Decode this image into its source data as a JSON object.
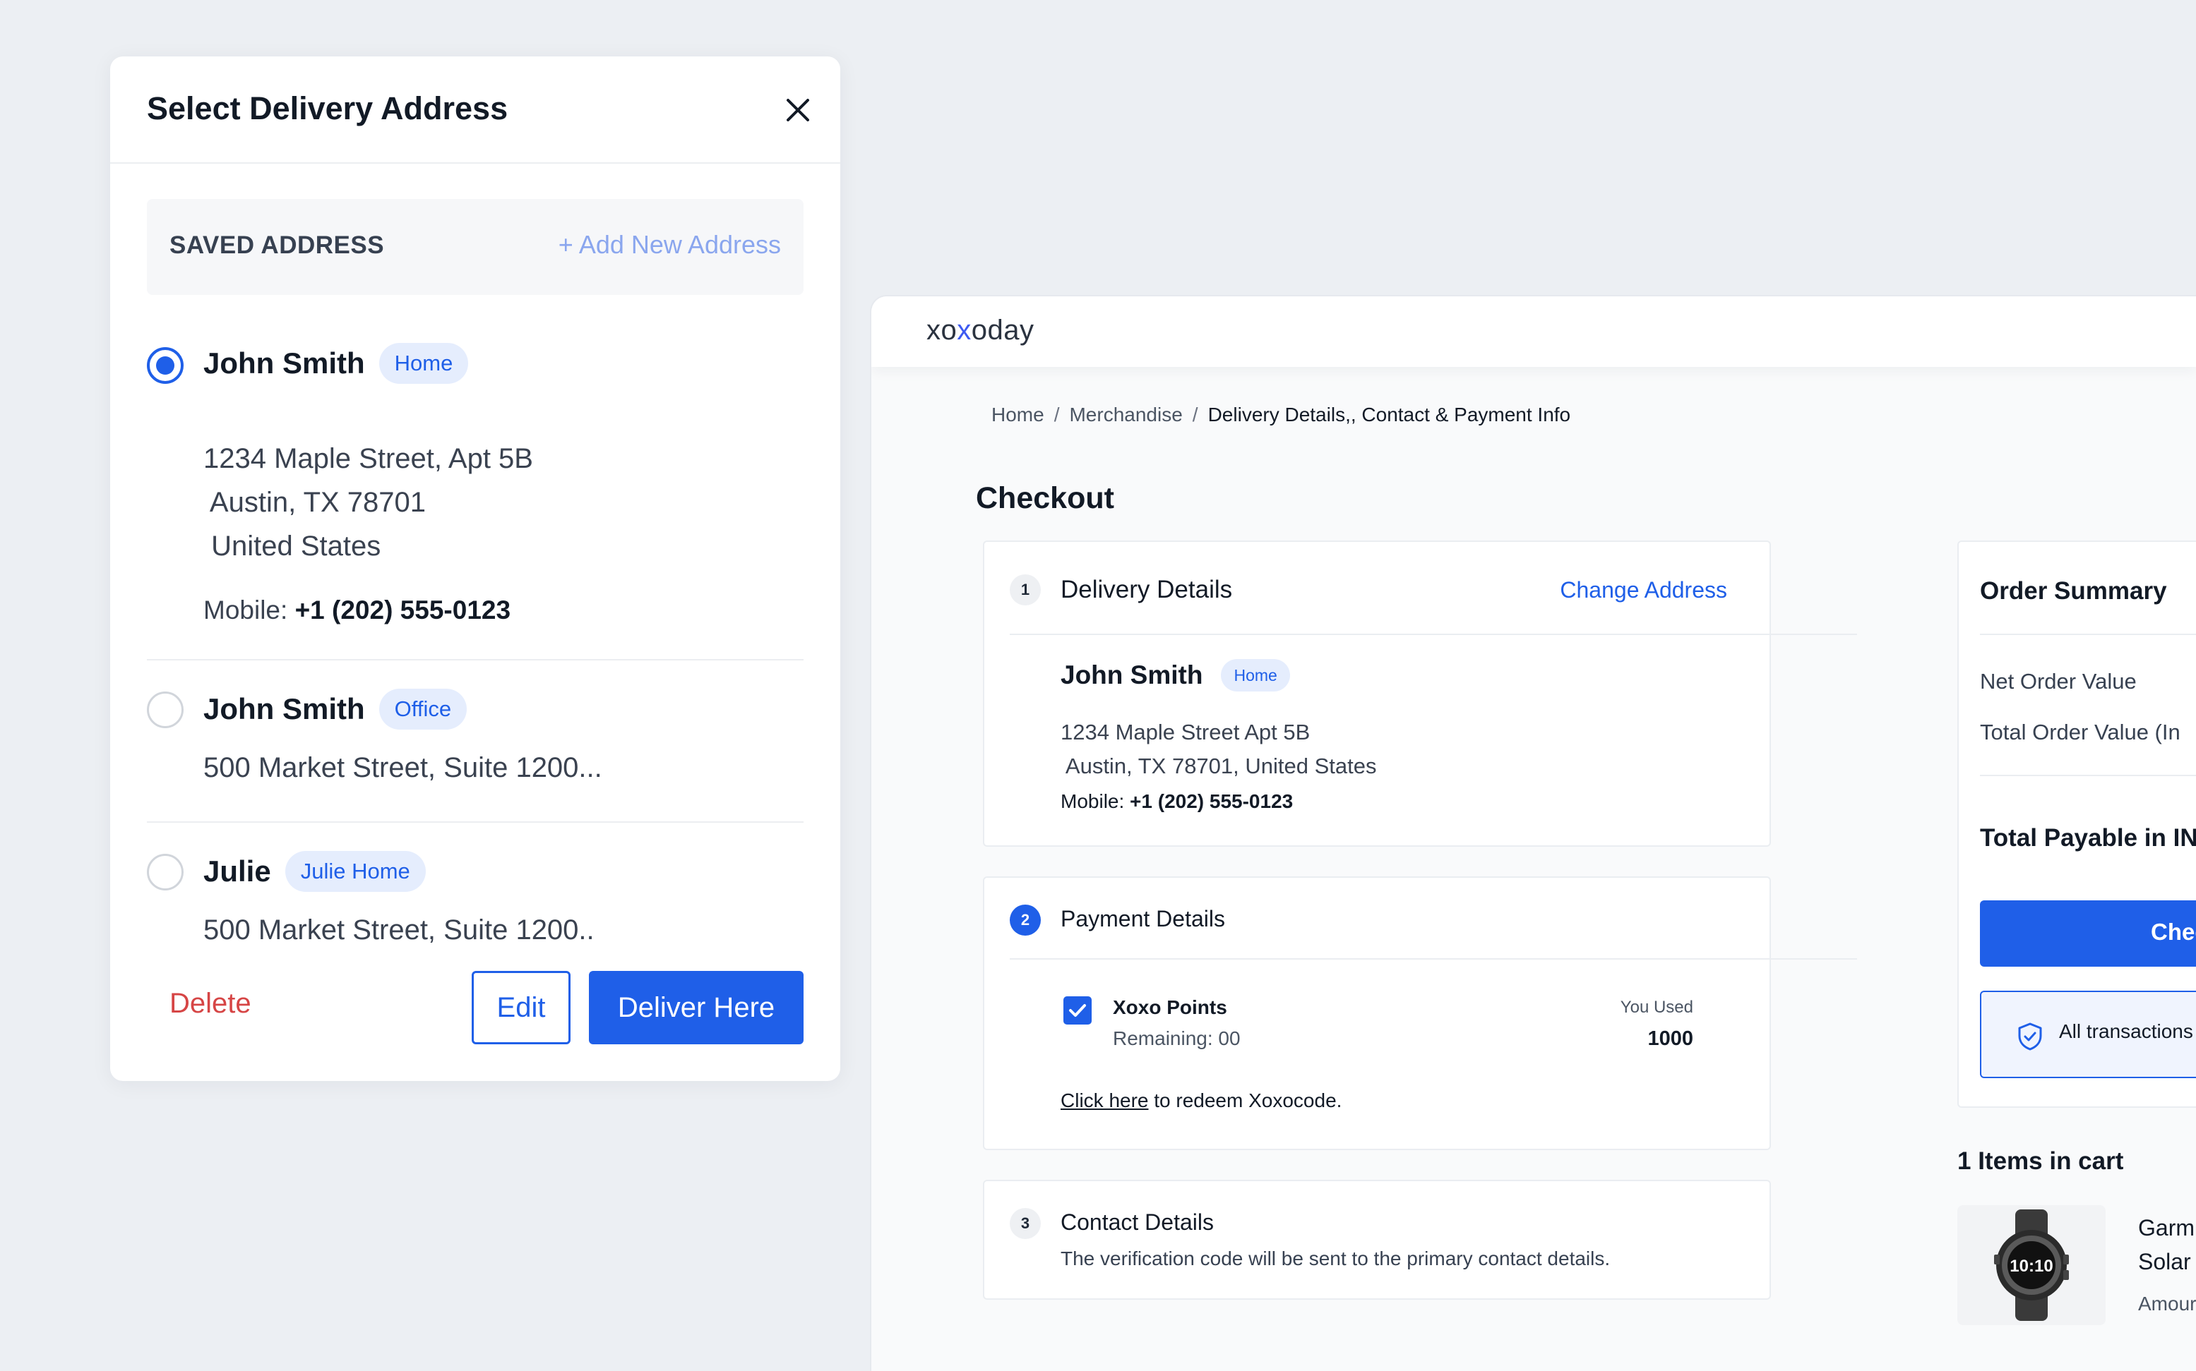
{
  "modal": {
    "title": "Select Delivery Address",
    "saved_label": "SAVED ADDRESS",
    "add_new": "+ Add New Address",
    "addresses": [
      {
        "name": "John Smith",
        "tag": "Home",
        "selected": true,
        "lines": [
          "1234 Maple Street, Apt 5B",
          " Austin, TX 78701",
          " United States"
        ],
        "mobile_label": "Mobile:",
        "mobile": "+1 (202) 555-0123"
      },
      {
        "name": "John Smith",
        "tag": "Office",
        "selected": false,
        "lines": [
          "500 Market Street, Suite 1200..."
        ]
      },
      {
        "name": "Julie",
        "tag": "Julie Home",
        "selected": false,
        "lines": [
          "500 Market Street, Suite 1200.."
        ]
      }
    ],
    "delete_label": "Delete",
    "edit_label": "Edit",
    "deliver_label": "Deliver Here"
  },
  "checkout": {
    "logo": {
      "pre": "xo",
      "x": "x",
      "post": "oday"
    },
    "breadcrumb": [
      "Home",
      "Merchandise",
      "Delivery Details,, Contact & Payment Info"
    ],
    "breadcrumb_sep": "/",
    "title": "Checkout",
    "delivery": {
      "step": "1",
      "title": "Delivery Details",
      "change_label": "Change Address",
      "name": "John Smith",
      "tag": "Home",
      "line1": "1234 Maple Street Apt 5B",
      "line2": " Austin, TX 78701, United States",
      "mobile_label": "Mobile:",
      "mobile": "+1 (202) 555-0123"
    },
    "payment": {
      "step": "2",
      "title": "Payment Details",
      "points_label": "Xoxo Points",
      "remaining": "Remaining: 00",
      "used_label": "You Used",
      "used_value": "1000",
      "click_here": "Click here",
      "redeem_text": " to redeem Xoxocode."
    },
    "contact": {
      "step": "3",
      "title": "Contact Details",
      "subtitle": "The verification code will be sent to the primary contact details."
    },
    "summary": {
      "title": "Order Summary",
      "net_label": "Net Order Value",
      "total_label": "Total Order Value (In",
      "payable_label": "Total Payable in IN",
      "pay_button": "Chec",
      "secure_text": "All transactions"
    },
    "cart": {
      "title": "1 Items in cart",
      "item_line1": "Garm",
      "item_line2": "Solar",
      "amount_label": "Amour",
      "watch_face": "10:10"
    }
  },
  "colors": {
    "accent": "#1f5fe8",
    "danger": "#d64545",
    "badge_bg": "#e5edfd",
    "page_bg": "#eceff3"
  }
}
